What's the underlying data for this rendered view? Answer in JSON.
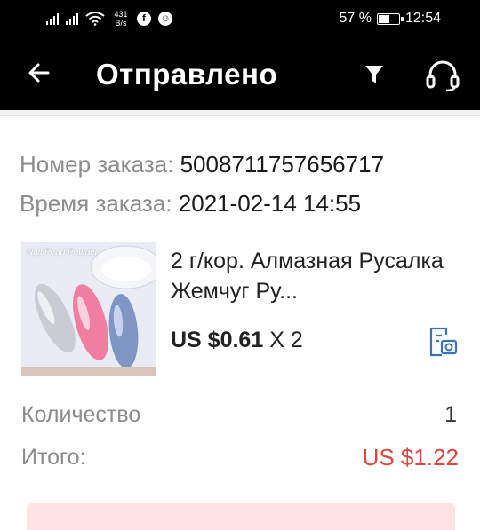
{
  "status_bar": {
    "net_speed_value": "431",
    "net_speed_unit": "B/s",
    "battery": "57 %",
    "time": "12:54",
    "battery_level": 0.57
  },
  "app_bar": {
    "title": "Отправлено",
    "back_icon": "arrow-left",
    "filter_icon": "filter",
    "support_icon": "headset"
  },
  "order": {
    "number_label": "Номер заказа:",
    "number_value": "5008711757656717",
    "time_label": "Время заказа:",
    "time_value": "2021-02-14 14:55",
    "product": {
      "image_caption": "Nail Pearl Powder",
      "title": "2 г/кор. Алмазная Русалка Жемчуг Ру...",
      "price": "US $0.61",
      "qty_multiplier": "X 2"
    },
    "quantity_label": "Количество",
    "quantity_value": "1",
    "total_label": "Итого:",
    "total_value": "US $1.22"
  },
  "colors": {
    "accent_total": "#e0443e",
    "icon_blue": "#3a73b8",
    "bar_bg": "#000000"
  }
}
